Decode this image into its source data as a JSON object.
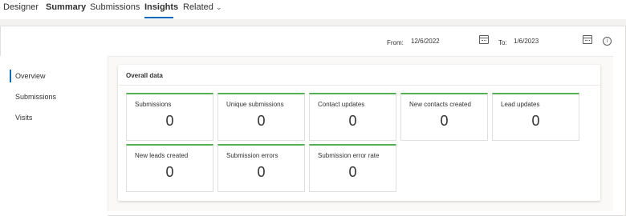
{
  "nav": {
    "tabs": [
      {
        "label": "Designer"
      },
      {
        "label": "Summary"
      },
      {
        "label": "Submissions"
      },
      {
        "label": "Insights"
      },
      {
        "label": "Related"
      }
    ]
  },
  "dates": {
    "from_label": "From:",
    "from_value": "12/6/2022",
    "to_label": "To:",
    "to_value": "1/6/2023"
  },
  "sidebar": {
    "items": [
      {
        "label": "Overview"
      },
      {
        "label": "Submissions"
      },
      {
        "label": "Visits"
      }
    ]
  },
  "overview": {
    "title": "Overall data",
    "metrics": [
      {
        "label": "Submissions",
        "value": "0"
      },
      {
        "label": "Unique submissions",
        "value": "0"
      },
      {
        "label": "Contact updates",
        "value": "0"
      },
      {
        "label": "New contacts created",
        "value": "0"
      },
      {
        "label": "Lead updates",
        "value": "0"
      },
      {
        "label": "New leads created",
        "value": "0"
      },
      {
        "label": "Submission errors",
        "value": "0"
      },
      {
        "label": "Submission error rate",
        "value": "0"
      }
    ]
  },
  "colors": {
    "accent": "#0f6cbd",
    "tile_top": "#54b054"
  },
  "icons": {
    "from_calendar": "calendar-icon",
    "to_calendar": "calendar-icon",
    "info": "info-icon",
    "related_dropdown": "chevron-down-icon"
  }
}
